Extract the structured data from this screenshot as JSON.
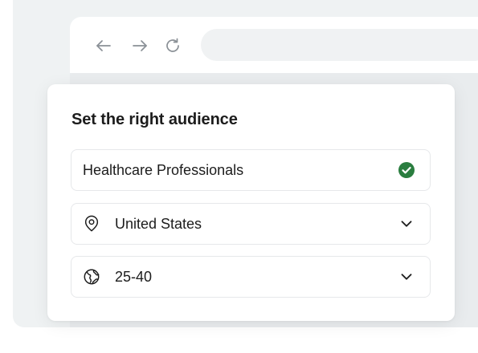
{
  "browser": {
    "nav": {
      "back_icon": "arrow-left-icon",
      "forward_icon": "arrow-right-icon",
      "reload_icon": "reload-icon"
    },
    "address_value": ""
  },
  "audience_card": {
    "title": "Set the right audience",
    "fields": [
      {
        "value": "Healthcare Professionals",
        "leading_icon": null,
        "trailing_icon": "check-circle-icon",
        "status_color": "#2a7d3f"
      },
      {
        "value": "United States",
        "leading_icon": "location-pin-icon",
        "trailing_icon": "chevron-down-icon"
      },
      {
        "value": "25-40",
        "leading_icon": "globe-icon",
        "trailing_icon": "chevron-down-icon"
      }
    ]
  },
  "colors": {
    "accent_green": "#2a7d3f",
    "text": "#1c1c1c",
    "frame_bg": "#eff2f3",
    "border": "#e6e8ea"
  }
}
